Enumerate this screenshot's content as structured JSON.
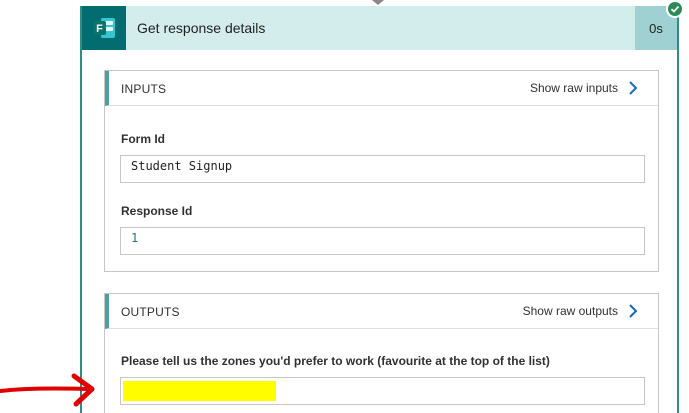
{
  "card": {
    "title": "Get response details",
    "duration": "0s",
    "status": "succeeded",
    "app_icon": "microsoft-forms-icon",
    "app_icon_letter": "F"
  },
  "inputs": {
    "section_title": "INPUTS",
    "raw_link": "Show raw inputs",
    "fields": [
      {
        "label": "Form Id",
        "value": "Student Signup"
      },
      {
        "label": "Response Id",
        "value": "1"
      }
    ]
  },
  "outputs": {
    "section_title": "OUTPUTS",
    "raw_link": "Show raw outputs",
    "fields": [
      {
        "label": "Please tell us the zones you'd prefer to work (favourite at the top of the list)",
        "value": ""
      }
    ]
  },
  "colors": {
    "header_bg": "#d3ecec",
    "accent": "#036c70",
    "border_accent": "#2f8d86",
    "link_chevron": "#0f6cbd",
    "highlight": "#fffd00",
    "annotation_arrow": "#e00000"
  }
}
